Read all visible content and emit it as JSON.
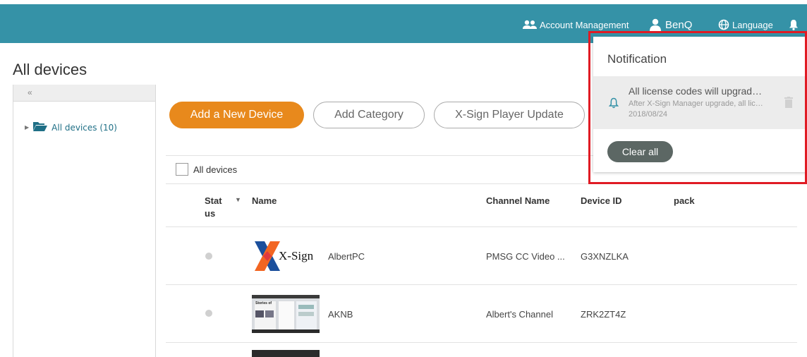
{
  "header": {
    "account_management": "Account Management",
    "user": "BenQ",
    "language": "Language",
    "icons": [
      "users-icon",
      "user-icon",
      "globe-icon",
      "bell-icon"
    ]
  },
  "page": {
    "title": "All devices"
  },
  "sidebar": {
    "collapse_label": "«",
    "tree": [
      {
        "label": "All devices (10)",
        "icon": "folder-open-icon"
      }
    ]
  },
  "toolbar": {
    "add_device": "Add a New Device",
    "add_category": "Add Category",
    "player_update": "X-Sign Player Update"
  },
  "table": {
    "select_all_label": "All devices",
    "columns": {
      "status_line1": "Stat",
      "status_line2": "us",
      "name": "Name",
      "channel": "Channel Name",
      "device_id": "Device ID",
      "pack": "pack"
    },
    "rows": [
      {
        "name": "AlbertPC",
        "channel": "PMSG CC Video ...",
        "device_id": "G3XNZLKA",
        "thumb": "X-Sign"
      },
      {
        "name": "AKNB",
        "channel": "Albert's Channel",
        "device_id": "ZRK2ZT4Z",
        "thumb": "Stories of"
      }
    ]
  },
  "notification": {
    "title": "Notification",
    "items": [
      {
        "title": "All license codes will upgrad…",
        "body": "After X-Sign Manager upgrade, all lic…",
        "date": "2018/08/24"
      }
    ],
    "clear_all": "Clear all"
  },
  "colors": {
    "header": "#3592a7",
    "primary_button": "#e8891c",
    "highlight": "#e01b24",
    "link": "#1f6f86"
  }
}
